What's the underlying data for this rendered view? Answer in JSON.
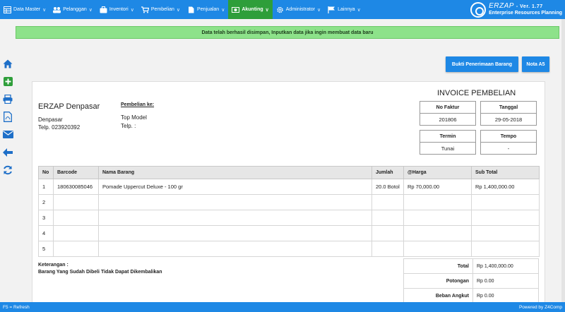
{
  "nav": {
    "items": [
      {
        "label": "Data Master",
        "icon": "table-icon"
      },
      {
        "label": "Pelanggan",
        "icon": "users-icon"
      },
      {
        "label": "Inventori",
        "icon": "briefcase-icon"
      },
      {
        "label": "Pembelian",
        "icon": "cart-icon"
      },
      {
        "label": "Penjualan",
        "icon": "file-icon"
      },
      {
        "label": "Akunting",
        "icon": "money-icon"
      },
      {
        "label": "Administrator",
        "icon": "gear-icon"
      },
      {
        "label": "Lainnya",
        "icon": "flag-icon"
      }
    ],
    "active_label": "Akunting"
  },
  "brand": {
    "name": "ERZAP",
    "version": "- Ver. 1.77",
    "subtitle": "Enterprise Resources Planning"
  },
  "alert": {
    "message": "Data telah berhasil disimpan, Inputkan data jika ingin membuat data baru"
  },
  "side_toolbar": [
    "home-icon",
    "add-icon",
    "print-icon",
    "pdf-icon",
    "email-icon",
    "back-icon",
    "refresh-icon"
  ],
  "actions": {
    "receipt_button": "Bukti Penerimaan Barang",
    "nota_button": "Nota A5"
  },
  "invoice": {
    "title": "INVOICE PEMBELIAN",
    "company": {
      "name": "ERZAP Denpasar",
      "city": "Denpasar",
      "phone": "Telp. 023920392"
    },
    "buyer": {
      "heading": "Pembelian ke:",
      "name": "Top Model",
      "phone": "Telp. :"
    },
    "info": {
      "faktur_label": "No Faktur",
      "faktur_value": "201806",
      "tanggal_label": "Tanggal",
      "tanggal_value": "29-05-2018",
      "termin_label": "Termin",
      "termin_value": "Tunai",
      "tempo_label": "Tempo",
      "tempo_value": "-"
    },
    "table": {
      "headers": [
        "No",
        "Barcode",
        "Nama Barang",
        "Jumlah",
        "@Harga",
        "Sub Total"
      ],
      "rows": [
        [
          "1",
          "180630085046",
          "Pomade Uppercut Deluxe - 100 gr",
          "20.0 Botol",
          "Rp 70,000.00",
          "Rp 1,400,000.00"
        ],
        [
          "2",
          "",
          "",
          "",
          "",
          ""
        ],
        [
          "3",
          "",
          "",
          "",
          "",
          ""
        ],
        [
          "4",
          "",
          "",
          "",
          "",
          ""
        ],
        [
          "5",
          "",
          "",
          "",
          "",
          ""
        ]
      ]
    },
    "notes_label": "Keterangan :",
    "notes_text": "Barang Yang Sudah Dibeli Tidak Dapat Dikembalikan",
    "summary": [
      {
        "label": "Total",
        "value": "Rp 1,400,000.00"
      },
      {
        "label": "Potongan",
        "value": "Rp 0.00"
      },
      {
        "label": "Beban Angkut",
        "value": "Rp 0.00"
      }
    ]
  },
  "footer": {
    "left": "F5 = Refresh",
    "right": "Powered by Z4Comp"
  },
  "colors": {
    "nav_bg": "#1e88e5",
    "nav_active": "#2e9e3a",
    "alert_bg": "#8de28a",
    "side_icon": "#1e6fc8",
    "add_icon": "#2e9e3a"
  }
}
